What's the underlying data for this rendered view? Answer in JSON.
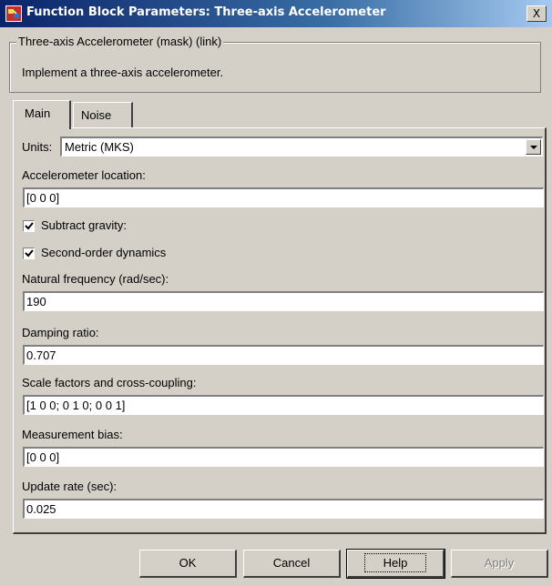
{
  "window": {
    "title": "Function Block Parameters: Three-axis Accelerometer",
    "close_glyph": "X"
  },
  "description": {
    "group_label": "Three-axis Accelerometer (mask) (link)",
    "text": "Implement a three-axis accelerometer."
  },
  "tabs": [
    {
      "label": "Main",
      "selected": true
    },
    {
      "label": "Noise",
      "selected": false
    }
  ],
  "units": {
    "label": "Units:",
    "value": "Metric (MKS)"
  },
  "fields": {
    "location": {
      "label": "Accelerometer location:",
      "value": "[0 0 0]"
    },
    "natural_frequency": {
      "label": "Natural frequency (rad/sec):",
      "value": "190"
    },
    "damping": {
      "label": "Damping ratio:",
      "value": "0.707"
    },
    "scale": {
      "label": "Scale factors and cross-coupling:",
      "value": "[1 0 0; 0 1 0; 0 0 1]"
    },
    "bias": {
      "label": "Measurement bias:",
      "value": "[0 0 0]"
    },
    "update_rate": {
      "label": "Update rate (sec):",
      "value": "0.025"
    }
  },
  "checkboxes": {
    "subtract_gravity": {
      "label": "Subtract gravity:",
      "checked": true
    },
    "second_order": {
      "label": "Second-order dynamics",
      "checked": true
    }
  },
  "buttons": {
    "ok": "OK",
    "cancel": "Cancel",
    "help": "Help",
    "apply": "Apply"
  },
  "colors": {
    "titlebar_start": "#0a246a",
    "titlebar_end": "#a6caf0",
    "face": "#d4d0c8"
  }
}
